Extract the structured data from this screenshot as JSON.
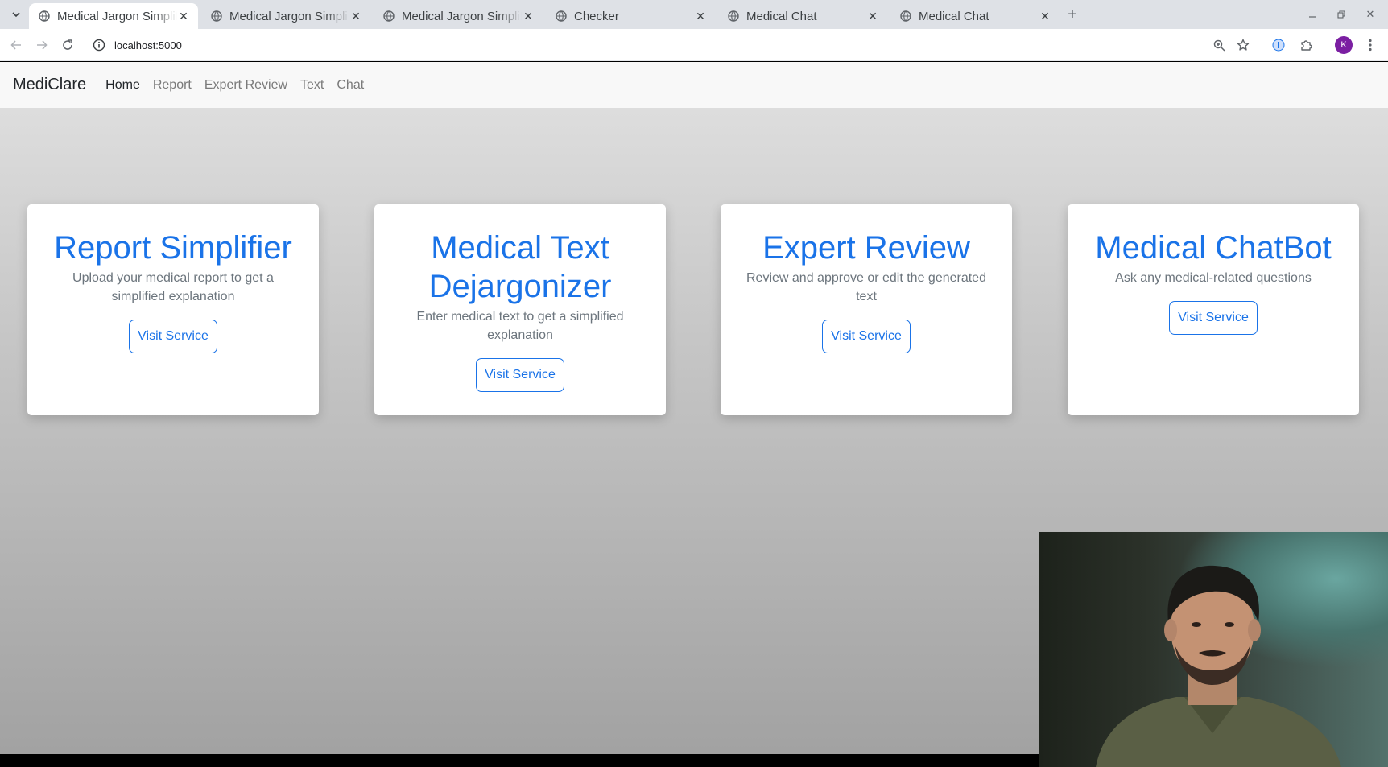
{
  "browser": {
    "tabs": [
      {
        "title": "Medical Jargon Simplifier",
        "active": true
      },
      {
        "title": "Medical Jargon Simplifier",
        "active": false
      },
      {
        "title": "Medical Jargon Simplifier",
        "active": false
      },
      {
        "title": "Checker",
        "active": false
      },
      {
        "title": "Medical Chat",
        "active": false
      },
      {
        "title": "Medical Chat",
        "active": false
      }
    ],
    "url": "localhost:5000",
    "profile_initial": "K"
  },
  "navbar": {
    "brand": "MediClare",
    "links": [
      {
        "label": "Home",
        "active": true
      },
      {
        "label": "Report",
        "active": false
      },
      {
        "label": "Expert Review",
        "active": false
      },
      {
        "label": "Text",
        "active": false
      },
      {
        "label": "Chat",
        "active": false
      }
    ]
  },
  "cards": [
    {
      "title": "Report Simplifier",
      "text": "Upload your medical report to get a simplified explanation",
      "button": "Visit Service"
    },
    {
      "title": "Medical Text Dejargonizer",
      "text": "Enter medical text to get a simplified explanation",
      "button": "Visit Service"
    },
    {
      "title": "Expert Review",
      "text": "Review and approve or edit the generated text",
      "button": "Visit Service"
    },
    {
      "title": "Medical ChatBot",
      "text": "Ask any medical-related questions",
      "button": "Visit Service"
    }
  ],
  "colors": {
    "accent": "#1a73e8",
    "avatar": "#7b1fa2"
  }
}
